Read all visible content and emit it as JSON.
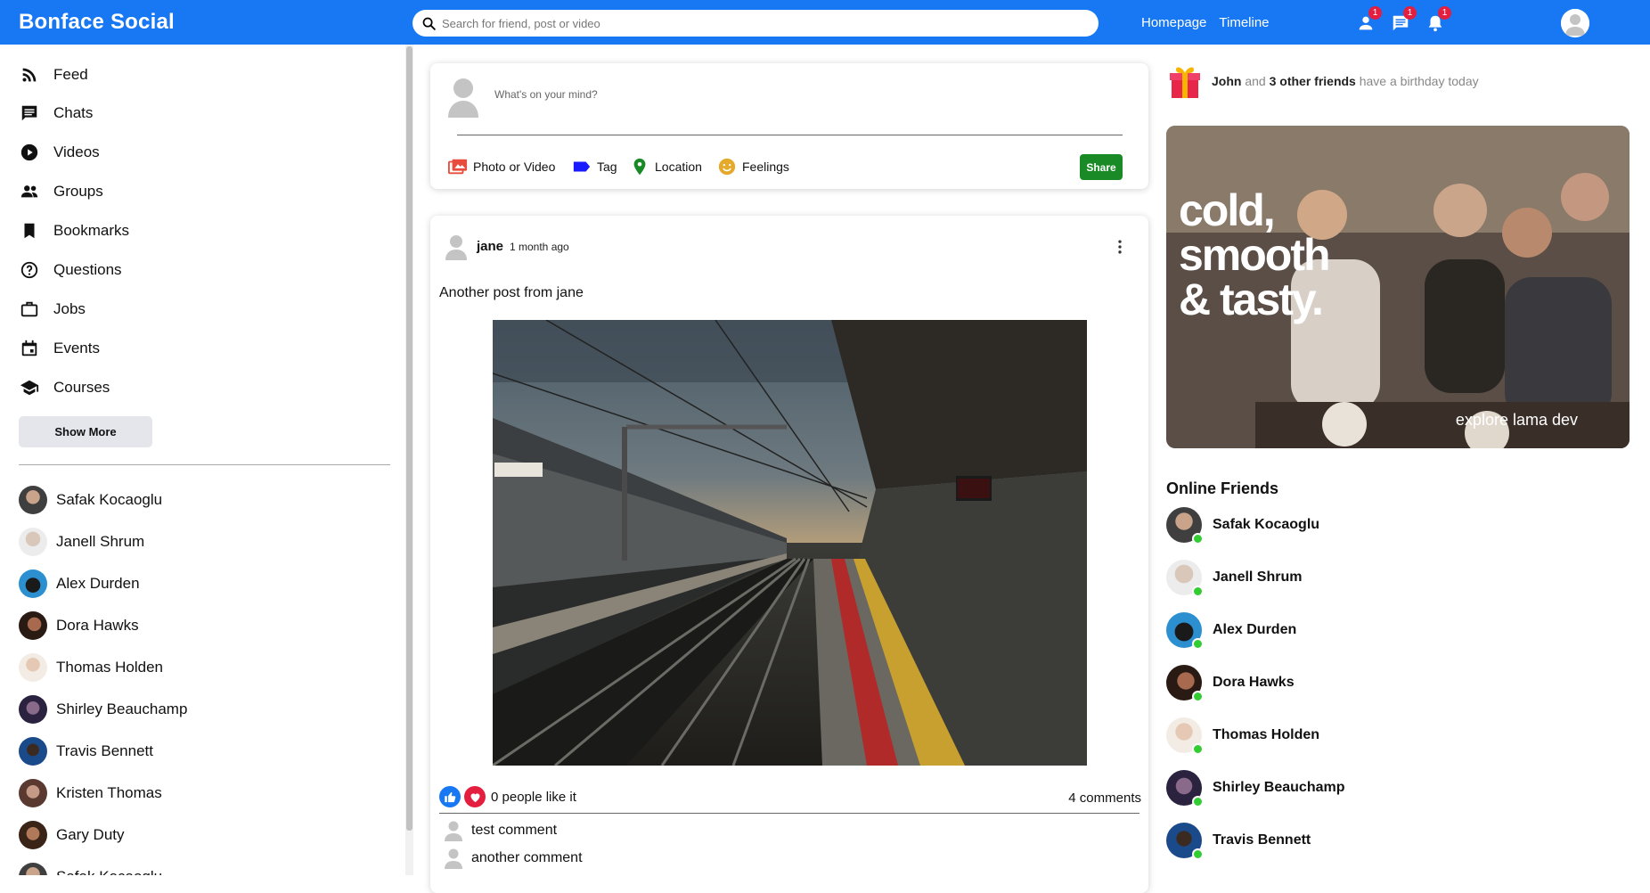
{
  "app": {
    "title": "Bonface Social"
  },
  "search": {
    "placeholder": "Search for friend, post or video"
  },
  "topbar": {
    "links": [
      "Homepage",
      "Timeline"
    ],
    "badges": {
      "friends": "1",
      "messages": "1",
      "notifications": "1"
    },
    "icons": [
      "person-icon",
      "chat-icon",
      "bell-icon"
    ],
    "accent": "#1877f2"
  },
  "sidebar": {
    "items": [
      {
        "label": "Feed",
        "icon": "rss-feed-icon"
      },
      {
        "label": "Chats",
        "icon": "chat-icon"
      },
      {
        "label": "Videos",
        "icon": "play-circle-icon"
      },
      {
        "label": "Groups",
        "icon": "group-icon"
      },
      {
        "label": "Bookmarks",
        "icon": "bookmark-icon"
      },
      {
        "label": "Questions",
        "icon": "help-circle-icon"
      },
      {
        "label": "Jobs",
        "icon": "work-icon"
      },
      {
        "label": "Events",
        "icon": "event-icon"
      },
      {
        "label": "Courses",
        "icon": "school-icon"
      }
    ],
    "show_more": "Show More",
    "friends": [
      "Safak Kocaoglu",
      "Janell Shrum",
      "Alex Durden",
      "Dora Hawks",
      "Thomas Holden",
      "Shirley Beauchamp",
      "Travis Bennett",
      "Kristen Thomas",
      "Gary Duty",
      "Safak Kocaoglu"
    ]
  },
  "share": {
    "placeholder": "What's on your mind?",
    "options": [
      {
        "label": "Photo or Video",
        "icon": "perm-media-icon",
        "color": "#e74c3c"
      },
      {
        "label": "Tag",
        "icon": "label-icon",
        "color": "#1a1aff"
      },
      {
        "label": "Location",
        "icon": "room-icon",
        "color": "#1a8a27"
      },
      {
        "label": "Feelings",
        "icon": "emoji-icon",
        "color": "#e5a92b"
      }
    ],
    "button": "Share",
    "button_color": "#1a8a27"
  },
  "post": {
    "user": "jane",
    "time": "1 month ago",
    "text": "Another post from jane",
    "likes": "0 people like it",
    "comments": "4 comments",
    "comment_list": [
      "test comment",
      "another comment"
    ]
  },
  "rightbar": {
    "birthday": {
      "name": "John",
      "and": "and",
      "others": "3 other friends",
      "rest": "have a birthday today"
    },
    "ad": {
      "headline_lines": [
        "cold,",
        "smooth",
        "& tasty."
      ],
      "tagline": "explore lama dev"
    },
    "online_title": "Online Friends",
    "online": [
      "Safak Kocaoglu",
      "Janell Shrum",
      "Alex Durden",
      "Dora Hawks",
      "Thomas Holden",
      "Shirley Beauchamp",
      "Travis Bennett"
    ],
    "online_color": "#32cd32"
  }
}
